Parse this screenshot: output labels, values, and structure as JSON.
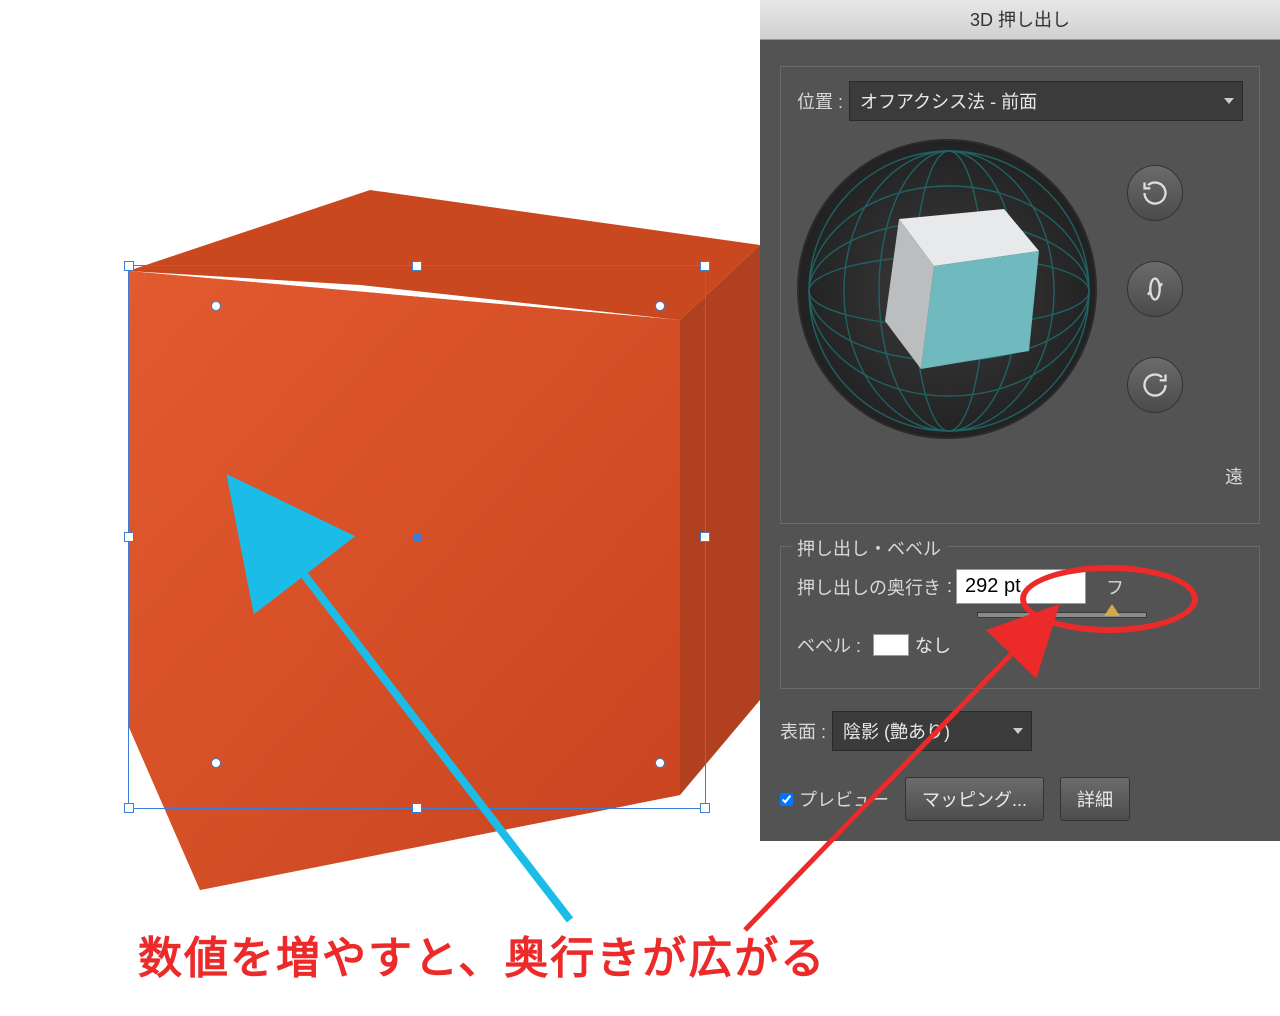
{
  "dialog": {
    "title": "3D 押し出し",
    "position_label": "位置 :",
    "position_value": "オフアクシス法 - 前面",
    "perspective_label": "遠",
    "extrude_section": "押し出し・ベベル",
    "depth_label": "押し出しの奥行き",
    "depth_value": "292 pt",
    "depth_right_marker": "フ",
    "bevel_label": "ベベル :",
    "bevel_value": "なし",
    "surface_label": "表面 :",
    "surface_value": "陰影 (艶あり)",
    "preview_label": "プレビュー",
    "mapping_button": "マッピング...",
    "details_button": "詳細"
  },
  "annotations": {
    "caption": "数値を増やすと、奥行きが広がる"
  },
  "colors": {
    "cube_top": "#cc5026",
    "cube_front": "#dc4f28",
    "cube_side": "#b0401f",
    "selection": "#3b7dd8",
    "panel": "#535353",
    "annotation": "#ec2a2a",
    "cyan_arrow": "#1cbce8"
  }
}
